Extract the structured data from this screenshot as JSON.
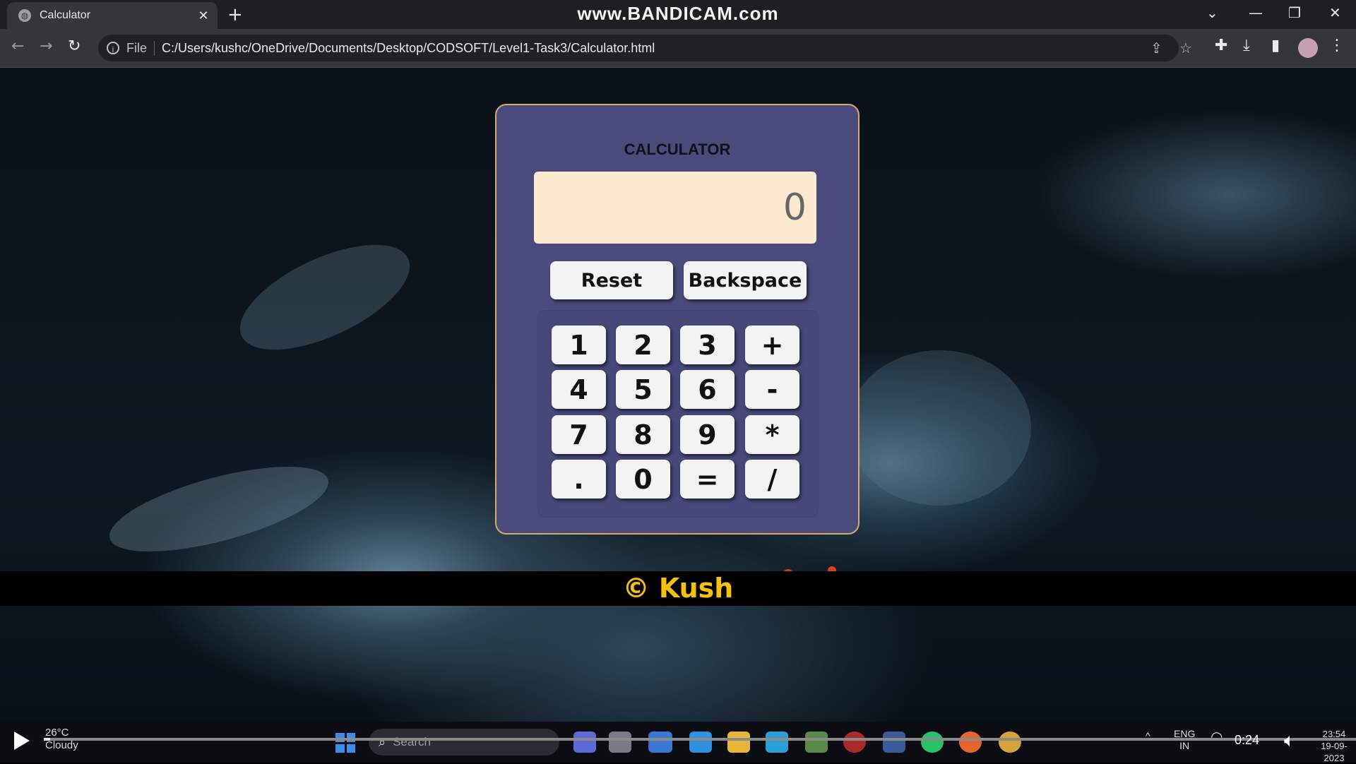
{
  "browser": {
    "tab_title": "Calculator",
    "tab_close": "✕",
    "new_tab": "+",
    "watermark": "www.BANDICAM.com",
    "scheme": "File",
    "url": "C:/Users/kushc/OneDrive/Documents/Desktop/CODSOFT/Level1-Task3/Calculator.html"
  },
  "calculator": {
    "title": "CALCULATOR",
    "display_value": "0",
    "reset_label": "Reset",
    "backspace_label": "Backspace",
    "keys": [
      "1",
      "2",
      "3",
      "+",
      "4",
      "5",
      "6",
      "-",
      "7",
      "8",
      "9",
      "*",
      ".",
      "0",
      "=",
      "/"
    ]
  },
  "footer": {
    "text": "© Kush"
  },
  "taskbar": {
    "temperature": "26°C",
    "weather": "Cloudy",
    "search_placeholder": "Search",
    "lang_top": "ENG",
    "lang_bottom": "IN",
    "clock_time": "23:54",
    "clock_date": "19-09-2023"
  },
  "player": {
    "timecode": "0:24",
    "progress": 0.005
  },
  "colors": {
    "calc_bg": "#4a4a7c",
    "calc_border": "#d9a86a",
    "display_bg": "#fde8d0",
    "footer_text": "#f4c20d"
  }
}
